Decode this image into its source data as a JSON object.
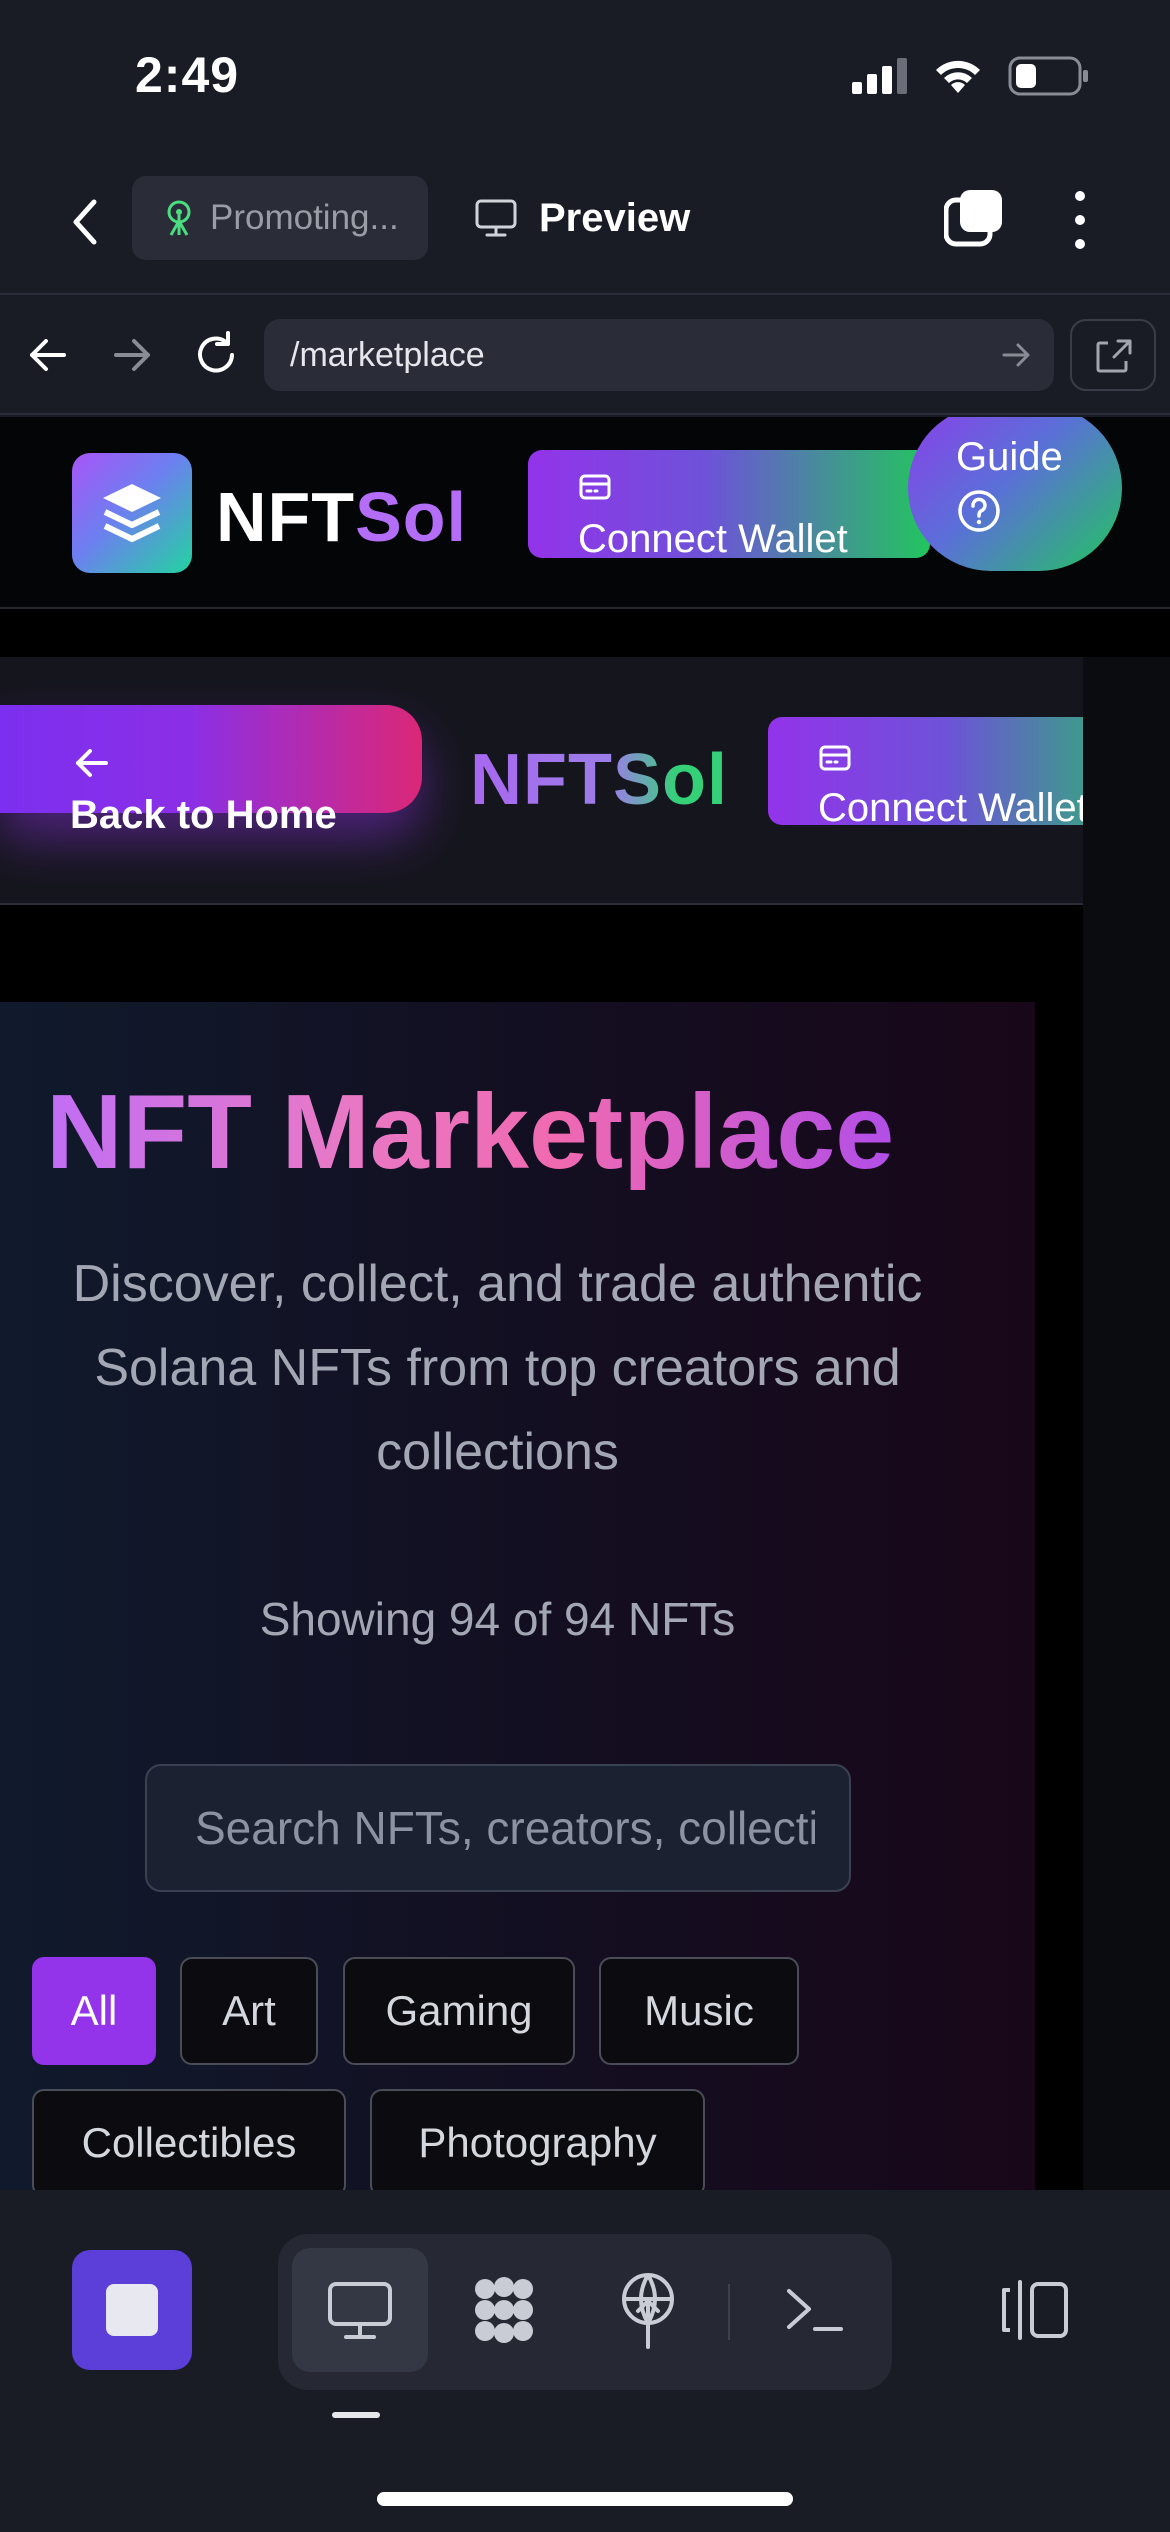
{
  "status_bar": {
    "time": "2:49",
    "icons": [
      "cellular-signal-icon",
      "wifi-icon",
      "battery-icon"
    ]
  },
  "app_bar": {
    "promo_label": "Promoting...",
    "preview_label": "Preview"
  },
  "browser": {
    "url": "/marketplace"
  },
  "site_header": {
    "logo_nft": "NFT",
    "logo_sol": "Sol",
    "connect_wallet_label": "Connect Wallet",
    "guide_label": "Guide"
  },
  "inner_header": {
    "back_label": "Back to Home",
    "logo": "NFTSol",
    "connect_wallet_label": "Connect Wallet"
  },
  "hero": {
    "title": "NFT Marketplace",
    "subtitle": "Discover, collect, and trade authentic Solana NFTs from top creators and collections",
    "count_text": "Showing 94 of 94 NFTs",
    "search_placeholder": "Search NFTs, creators, collections...",
    "categories": [
      {
        "label": "All",
        "active": true
      },
      {
        "label": "Art",
        "active": false
      },
      {
        "label": "Gaming",
        "active": false
      },
      {
        "label": "Music",
        "active": false
      },
      {
        "label": "Collectibles",
        "active": false
      },
      {
        "label": "Photography",
        "active": false
      }
    ]
  },
  "colors": {
    "accent_purple": "#9333ea",
    "accent_green": "#22c55e",
    "accent_pink": "#db2777",
    "chrome_bg": "#1a1c25"
  },
  "bottom_bar": {
    "tabs": [
      "monitor-icon",
      "apps-icon",
      "deploy-icon",
      "terminal-icon"
    ],
    "active_tab": "monitor-icon"
  }
}
